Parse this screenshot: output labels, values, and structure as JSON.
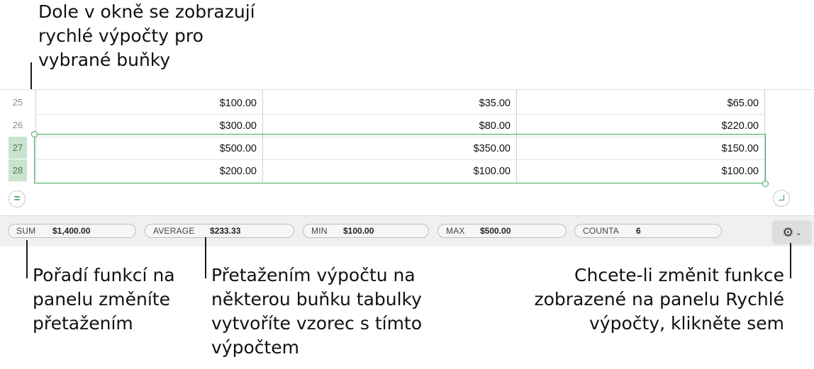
{
  "callouts": {
    "top": "Dole v okně se zobrazují\nrychlé výpočty pro\nvybrané buňky",
    "order": "Pořadí funkcí na\npanelu změníte\npřetažením",
    "drag": "Přetažením výpočtu na\nněkterou buňku tabulky\nvytvoříte vzorec s tímto\nvýpočtem",
    "change": "Chcete-li změnit funkce\nzobrazené na panelu Rychlé\nvýpočty, klikněte sem"
  },
  "sheet": {
    "rows": [
      {
        "num": "25",
        "selected": false,
        "cells": [
          "$100.00",
          "$35.00",
          "$65.00"
        ]
      },
      {
        "num": "26",
        "selected": false,
        "cells": [
          "$300.00",
          "$80.00",
          "$220.00"
        ]
      },
      {
        "num": "27",
        "selected": true,
        "cells": [
          "$500.00",
          "$350.00",
          "$150.00"
        ]
      },
      {
        "num": "28",
        "selected": true,
        "cells": [
          "$200.00",
          "$100.00",
          "$100.00"
        ]
      }
    ],
    "equals_symbol": "="
  },
  "calc_bar": {
    "items": [
      {
        "label": "SUM",
        "value": "$1,400.00"
      },
      {
        "label": "AVERAGE",
        "value": "$233.33"
      },
      {
        "label": "MIN",
        "value": "$100.00"
      },
      {
        "label": "MAX",
        "value": "$500.00"
      },
      {
        "label": "COUNTA",
        "value": "6"
      }
    ],
    "settings_icon": "gear-icon",
    "chevron_icon": "chevron-down-icon"
  },
  "colors": {
    "selection": "#3aa55a",
    "selected_row_header": "#c9e3cf"
  }
}
